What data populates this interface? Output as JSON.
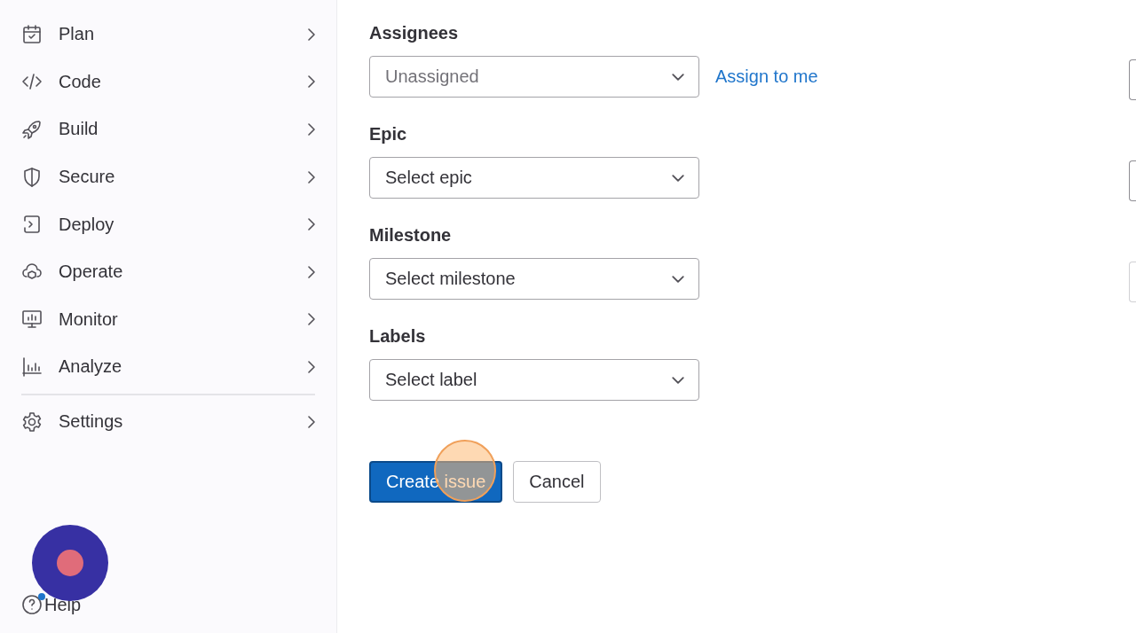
{
  "sidebar": {
    "items": [
      {
        "label": "Plan",
        "divider_before": false
      },
      {
        "label": "Code",
        "divider_before": false
      },
      {
        "label": "Build",
        "divider_before": false
      },
      {
        "label": "Secure",
        "divider_before": false
      },
      {
        "label": "Deploy",
        "divider_before": false
      },
      {
        "label": "Operate",
        "divider_before": false
      },
      {
        "label": "Monitor",
        "divider_before": false
      },
      {
        "label": "Analyze",
        "divider_before": false
      },
      {
        "label": "Settings",
        "divider_before": true
      }
    ],
    "help": {
      "label": "Help",
      "notification": true
    }
  },
  "form": {
    "fields": [
      {
        "label": "Assignees",
        "placeholder": "Unassigned",
        "link": "Assign to me"
      },
      {
        "label": "Epic",
        "value": "Select epic"
      },
      {
        "label": "Milestone",
        "value": "Select milestone"
      },
      {
        "label": "Labels",
        "value": "Select label"
      }
    ],
    "buttons": [
      {
        "label": "Create issue",
        "kind": "primary"
      },
      {
        "label": "Cancel",
        "kind": "secondary"
      }
    ]
  },
  "right_column": {
    "fields": [
      {
        "disabled": false
      },
      {
        "disabled": false
      },
      {
        "disabled": true
      }
    ]
  }
}
